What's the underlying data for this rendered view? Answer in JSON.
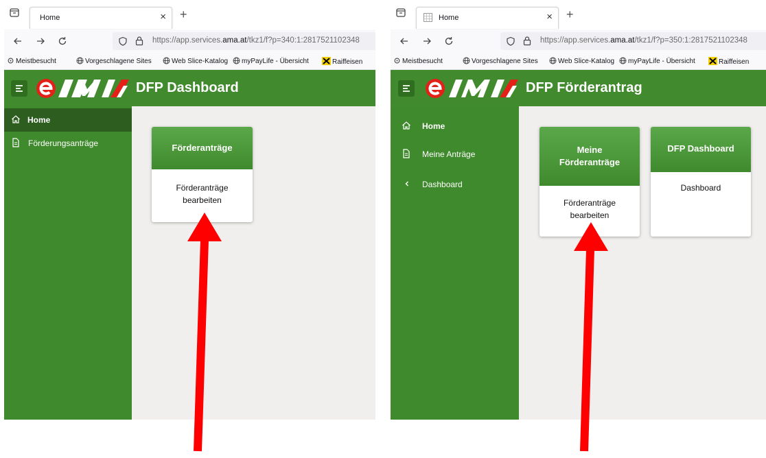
{
  "colors": {
    "appbar": "#418a2e",
    "sidebar": "#3f8a2c",
    "sidebar_active": "#2d5e20",
    "card_header": "#4c9a3b",
    "arrow": "#ff0000",
    "content_bg": "#f0efed"
  },
  "left": {
    "tab_title": "Home",
    "url_host_prefix": "https://app.services.",
    "url_host": "ama.at",
    "url_path": "/tkz1/f?p=340:1:2817521102348",
    "bookmarks": [
      "Meistbesucht",
      "Vorgeschlagene Sites",
      "Web Slice-Katalog",
      "myPayLife - Übersicht",
      "Raiffeisen"
    ],
    "app_title": "DFP Dashboard",
    "sidebar": [
      {
        "label": "Home",
        "icon": "home-icon"
      },
      {
        "label": "Förderungsanträge",
        "icon": "document-icon"
      }
    ],
    "cards": [
      {
        "title": "Förderanträge",
        "body_line1": "Förderanträge",
        "body_line2": "bearbeiten"
      }
    ]
  },
  "right": {
    "tab_title": "Home",
    "url_host_prefix": "https://app.services.",
    "url_host": "ama.at",
    "url_path": "/tkz1/f?p=350:1:2817521102348",
    "bookmarks": [
      "Meistbesucht",
      "Vorgeschlagene Sites",
      "Web Slice-Katalog",
      "myPayLife - Übersicht",
      "Raiffeisen"
    ],
    "app_title": "DFP Förderantrag",
    "sidebar": [
      {
        "label": "Home",
        "icon": "home-icon"
      },
      {
        "label": "Meine Anträge",
        "icon": "document-icon"
      },
      {
        "label": "Dashboard",
        "icon": "chevron-left-icon"
      }
    ],
    "cards": [
      {
        "title_line1": "Meine",
        "title_line2": "Förderanträge",
        "body_line1": "Förderanträge",
        "body_line2": "bearbeiten"
      },
      {
        "title": "DFP Dashboard",
        "body_line1": "Dashboard"
      }
    ]
  }
}
